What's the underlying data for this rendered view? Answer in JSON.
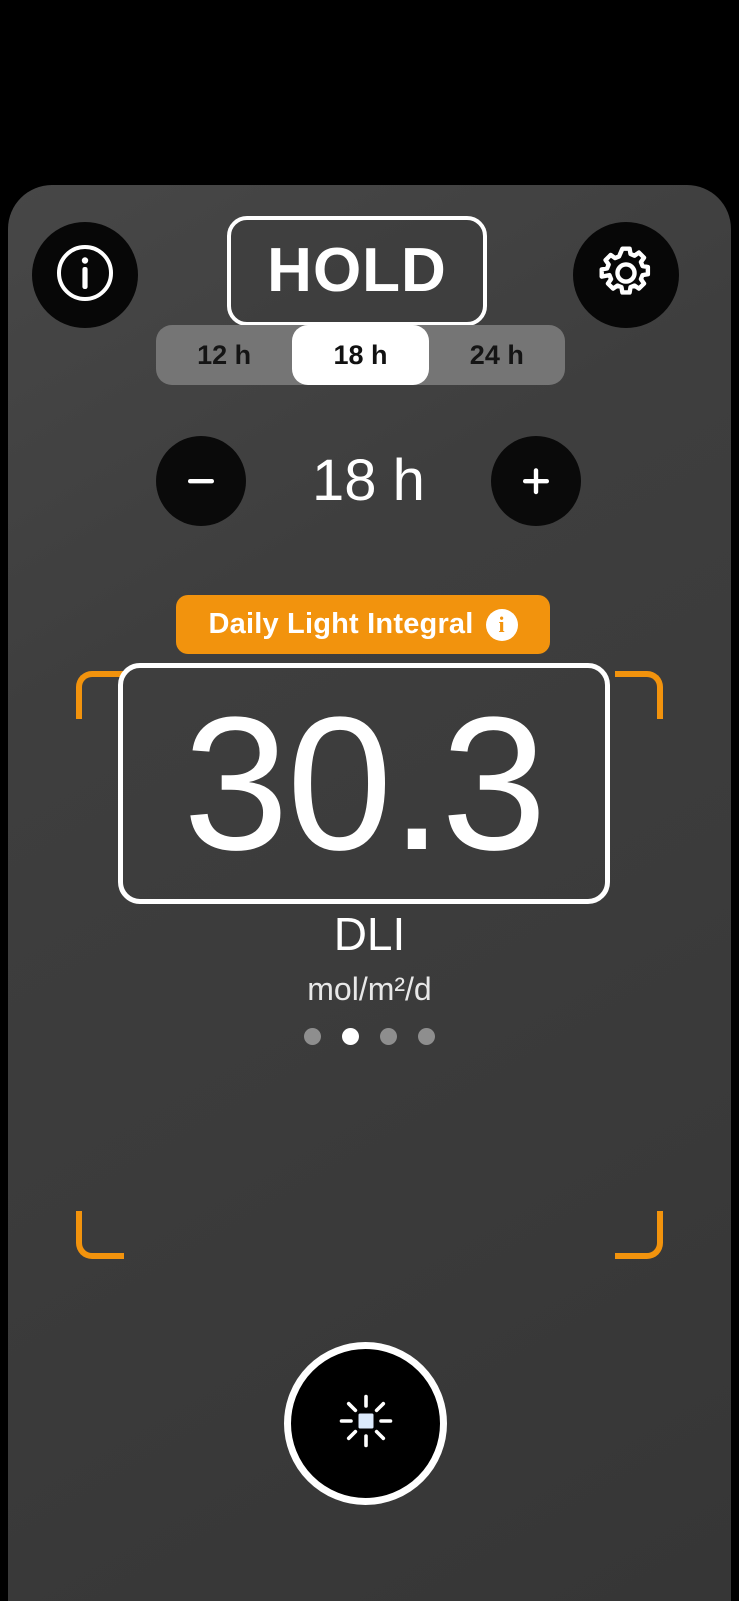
{
  "app": {
    "background_color": "#000000",
    "panel_color": "#3c3c3c",
    "accent_color": "#f2930d"
  },
  "top_bar": {
    "info_button": {
      "icon": "info-circle-icon",
      "label": "i"
    },
    "settings_button": {
      "icon": "gear-icon"
    },
    "hold_button": {
      "label": "HOLD",
      "active": true
    }
  },
  "duration_segmented": {
    "options": [
      {
        "label": "12 h",
        "selected": false
      },
      {
        "label": "18 h",
        "selected": true
      },
      {
        "label": "24 h",
        "selected": false
      }
    ]
  },
  "stepper": {
    "decrement_label": "−",
    "increment_label": "+",
    "value": "18 h"
  },
  "measurement": {
    "badge_label": "Daily Light Integral",
    "badge_info_icon": "info-circle-icon",
    "badge_info_label": "i",
    "value": "30.3",
    "name": "DLI",
    "units": "mol/m²/d"
  },
  "page_dots": {
    "count": 4,
    "active_index": 1
  },
  "bottom_bar": {
    "light_button": {
      "icon": "brightness-sun-icon"
    }
  }
}
